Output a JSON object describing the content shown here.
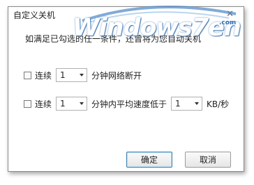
{
  "dialog": {
    "title": "自定义关机",
    "close_glyph": "✕",
    "description": "如满足已勾选的任一条件，还曾将为您自动关机"
  },
  "options": [
    {
      "checked": false,
      "prefix": "连续",
      "value": "1",
      "suffix": "分钟网络断开"
    },
    {
      "checked": false,
      "prefix": "连续",
      "value": "1",
      "suffix": "分钟内平均速度低于",
      "speed_value": "1",
      "unit": "KB/秒"
    }
  ],
  "buttons": {
    "ok": "确定",
    "cancel": "取消"
  },
  "watermark": {
    "text": "Windows7en",
    "domain": ".com"
  },
  "colors": {
    "accent": "#3c7fb1",
    "watermark": "#2f6eb5"
  }
}
